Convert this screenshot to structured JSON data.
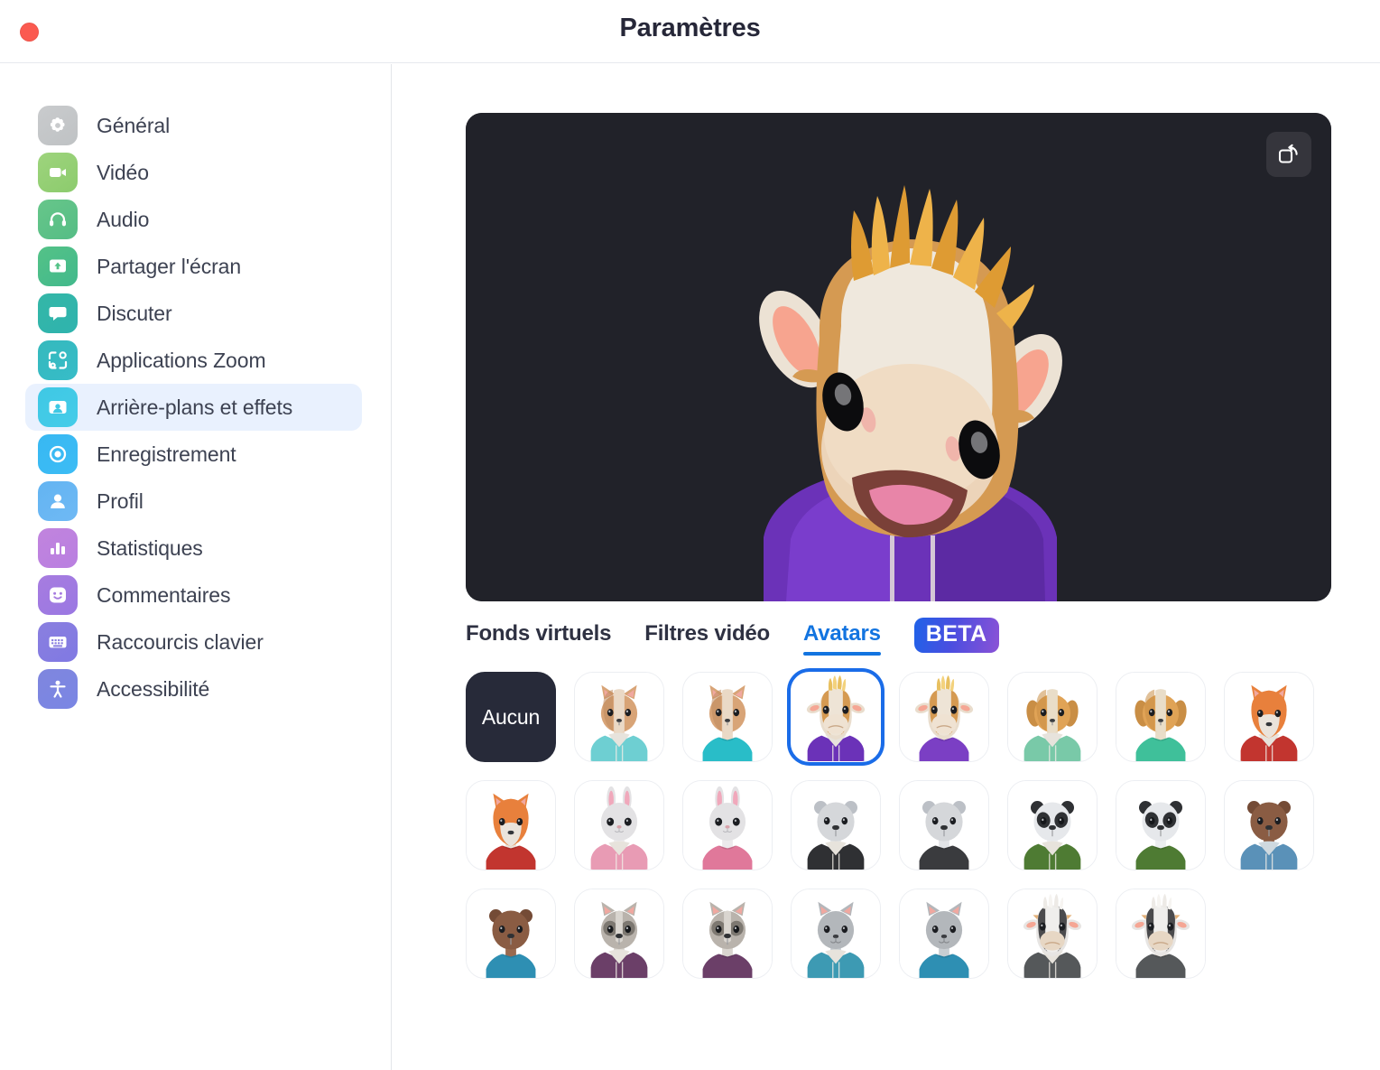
{
  "window": {
    "title": "Paramètres",
    "close_button": "close"
  },
  "sidebar": {
    "items": [
      {
        "label": "Général",
        "icon": "gear-icon",
        "color": "#c9cbcd",
        "color2": "#bfc2c4",
        "active": false
      },
      {
        "label": "Vidéo",
        "icon": "video-camera-icon",
        "color": "#9ed47d",
        "color2": "#8ccb6d",
        "active": false
      },
      {
        "label": "Audio",
        "icon": "headphones-icon",
        "color": "#67c68a",
        "color2": "#55bd85",
        "active": false
      },
      {
        "label": "Partager l'écran",
        "icon": "share-screen-icon",
        "color": "#54c287",
        "color2": "#42b98c",
        "active": false
      },
      {
        "label": "Discuter",
        "icon": "chat-bubble-icon",
        "color": "#34b7a7",
        "color2": "#2fb3ae",
        "active": false
      },
      {
        "label": "Applications Zoom",
        "icon": "zoom-apps-icon",
        "color": "#35b9bd",
        "color2": "#37bcc8",
        "active": false
      },
      {
        "label": "Arrière-plans et effets",
        "icon": "background-icon",
        "color": "#3fc8e4",
        "color2": "#45cce9",
        "active": true
      },
      {
        "label": "Enregistrement",
        "icon": "record-circle-icon",
        "color": "#38b8f2",
        "color2": "#3cbcf5",
        "active": false
      },
      {
        "label": "Profil",
        "icon": "person-icon",
        "color": "#63b4f2",
        "color2": "#6fb9f4",
        "active": false
      },
      {
        "label": "Statistiques",
        "icon": "bar-chart-icon",
        "color": "#c184de",
        "color2": "#b97fe0",
        "active": false
      },
      {
        "label": "Commentaires",
        "icon": "smiley-face-icon",
        "color": "#a77ce0",
        "color2": "#9a78e2",
        "active": false
      },
      {
        "label": "Raccourcis clavier",
        "icon": "keyboard-icon",
        "color": "#8a7fe0",
        "color2": "#8079e2",
        "active": false
      },
      {
        "label": "Accessibilité",
        "icon": "accessibility-icon",
        "color": "#7f86de",
        "color2": "#7a86e4",
        "active": false
      }
    ],
    "active_index": 6
  },
  "preview": {
    "background_color": "#212229",
    "flip_button_label": "flip-camera",
    "avatar": {
      "species": "cow",
      "hair": "blonde-mohawk",
      "hoodie_color": "#6b32b8",
      "face_color": "#eee0d0",
      "patch_color": "#d59a52"
    }
  },
  "tabs": [
    {
      "label": "Fonds virtuels",
      "active": false
    },
    {
      "label": "Filtres vidéo",
      "active": false
    },
    {
      "label": "Avatars",
      "active": true
    }
  ],
  "beta_badge": "BETA",
  "accent_color": "#1274e0",
  "selection_ring_color": "#1a6ce8",
  "avatars": {
    "none_label": "Aucun",
    "selected_index": 3,
    "items": [
      {
        "name": "Aucun",
        "kind": "none"
      },
      {
        "name": "chien-corgi-sweat-turquoise",
        "kind": "dog",
        "fur": "#d8a477",
        "fur2": "#c08a5f",
        "face": "#ead9c6",
        "shirt": "#6ecfd2",
        "hood": true,
        "ear": "upright"
      },
      {
        "name": "chien-corgi-tshirt-turquoise",
        "kind": "dog",
        "fur": "#d8a477",
        "fur2": "#c08a5f",
        "face": "#ead9c6",
        "shirt": "#29bdc8",
        "hood": false,
        "ear": "upright"
      },
      {
        "name": "vache-sweat-violet",
        "kind": "cow",
        "fur": "#e9ddcd",
        "fur2": "#d59a52",
        "face": "#efe2d2",
        "shirt": "#6b32b8",
        "hood": true,
        "ear": "side"
      },
      {
        "name": "vache-tshirt-violet",
        "kind": "cow",
        "fur": "#e9ddcd",
        "fur2": "#d59a52",
        "face": "#efe2d2",
        "shirt": "#7b3fc4",
        "hood": false,
        "ear": "side"
      },
      {
        "name": "chien-beagle-sweat-vert",
        "kind": "dog",
        "fur": "#e0a356",
        "fur2": "#c98e45",
        "face": "#e9ddc8",
        "shirt": "#79c9a8",
        "hood": true,
        "ear": "floppy"
      },
      {
        "name": "chien-beagle-tshirt-vert",
        "kind": "dog",
        "fur": "#e0a356",
        "fur2": "#c98e45",
        "face": "#e9ddc8",
        "shirt": "#3fc09a",
        "hood": false,
        "ear": "floppy"
      },
      {
        "name": "renard-sweat-rouge",
        "kind": "fox",
        "fur": "#e8803c",
        "fur2": "#d56c2c",
        "face": "#eae3db",
        "shirt": "#c2352f",
        "hood": true,
        "ear": "upright"
      },
      {
        "name": "renard-tshirt-rouge",
        "kind": "fox",
        "fur": "#e8803c",
        "fur2": "#d56c2c",
        "face": "#eae3db",
        "shirt": "#c2352f",
        "hood": false,
        "ear": "upright"
      },
      {
        "name": "lapin-sweat-rose",
        "kind": "rabbit",
        "fur": "#e3e2e4",
        "fur2": "#cfcfd3",
        "face": "#eceaec",
        "shirt": "#e89bb4",
        "hood": true,
        "ear": "long"
      },
      {
        "name": "lapin-tshirt-rose",
        "kind": "rabbit",
        "fur": "#e3e2e4",
        "fur2": "#cfcfd3",
        "face": "#eceaec",
        "shirt": "#e0789a",
        "hood": false,
        "ear": "long"
      },
      {
        "name": "ours-polaire-sweat-noir",
        "kind": "bear",
        "fur": "#d5d7da",
        "fur2": "#bcc0c6",
        "face": "#e2e4e7",
        "shirt": "#2f3033",
        "hood": true,
        "ear": "round"
      },
      {
        "name": "ours-polaire-tshirt-noir",
        "kind": "bear",
        "fur": "#d5d7da",
        "fur2": "#bcc0c6",
        "face": "#e2e4e7",
        "shirt": "#3a3b3e",
        "hood": false,
        "ear": "round"
      },
      {
        "name": "panda-sweat-vert",
        "kind": "panda",
        "fur": "#e6e8eb",
        "fur2": "#c9ced4",
        "face": "#eceef0",
        "shirt": "#4e7b33",
        "hood": true,
        "ear": "round"
      },
      {
        "name": "panda-tshirt-vert",
        "kind": "panda",
        "fur": "#e6e8eb",
        "fur2": "#c9ced4",
        "face": "#eceef0",
        "shirt": "#4e7b33",
        "hood": false,
        "ear": "round"
      },
      {
        "name": "ours-brun-sweat-bleu",
        "kind": "bear",
        "fur": "#8a5c43",
        "fur2": "#744b36",
        "face": "#9a6a4f",
        "shirt": "#5a91b8",
        "hood": true,
        "ear": "round"
      },
      {
        "name": "ours-brun-tshirt-bleu",
        "kind": "bear",
        "fur": "#8a5c43",
        "fur2": "#744b36",
        "face": "#9a6a4f",
        "shirt": "#2e8fb3",
        "hood": false,
        "ear": "round"
      },
      {
        "name": "raton-laveur-sweat-violet",
        "kind": "raccoon",
        "fur": "#b9b3ac",
        "fur2": "#98928c",
        "face": "#d9d5cf",
        "shirt": "#6b3f68",
        "hood": true,
        "ear": "upright"
      },
      {
        "name": "raton-laveur-tshirt-violet",
        "kind": "raccoon",
        "fur": "#b9b3ac",
        "fur2": "#98928c",
        "face": "#d9d5cf",
        "shirt": "#6b3f68",
        "hood": false,
        "ear": "upright"
      },
      {
        "name": "chat-gris-sweat-bleu",
        "kind": "cat",
        "fur": "#b3b7bb",
        "fur2": "#9aa0a5",
        "face": "#c9ced2",
        "shirt": "#3d9ab3",
        "hood": true,
        "ear": "upright"
      },
      {
        "name": "chat-gris-tshirt-bleu",
        "kind": "cat",
        "fur": "#b3b7bb",
        "fur2": "#9aa0a5",
        "face": "#c9ced2",
        "shirt": "#2e8fb3",
        "hood": false,
        "ear": "upright"
      },
      {
        "name": "vache-blanche-sweat-gris",
        "kind": "cowwhite",
        "fur": "#e7e5e3",
        "fur2": "#4b4b4d",
        "face": "#e7d7c4",
        "shirt": "#55585a",
        "hood": true,
        "ear": "side"
      },
      {
        "name": "vache-blanche-tshirt-gris",
        "kind": "cowwhite",
        "fur": "#e7e5e3",
        "fur2": "#4b4b4d",
        "face": "#e7d7c4",
        "shirt": "#55585a",
        "hood": false,
        "ear": "side"
      }
    ]
  }
}
